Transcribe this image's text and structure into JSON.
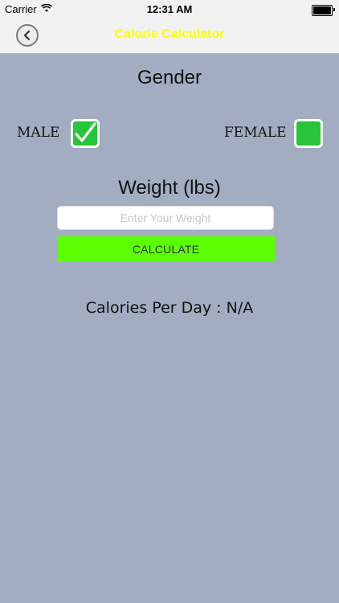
{
  "status_bar": {
    "carrier": "Carrier",
    "time": "12:31 AM",
    "wifi_icon": "wifi-icon",
    "battery_icon": "battery-icon"
  },
  "nav": {
    "title": "Calorie Calculator",
    "back_icon": "chevron-left-icon",
    "title_color": "#ffff00"
  },
  "gender": {
    "label": "Gender",
    "male_label": "MALE",
    "female_label": "FEMALE",
    "male_checked": true,
    "female_checked": false,
    "checkbox_color": "#28c43a"
  },
  "weight": {
    "label": "Weight (lbs)",
    "value": "",
    "placeholder": "Enter Your Weight"
  },
  "calculate": {
    "label": "CALCULATE",
    "color": "#5aff00"
  },
  "result": {
    "text": "Calories Per Day : N/A"
  },
  "colors": {
    "background": "#a2adc1"
  }
}
